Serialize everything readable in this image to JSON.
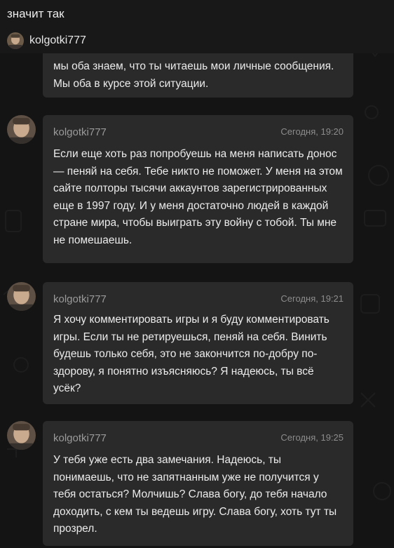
{
  "header": {
    "title": "значит так",
    "user_name": "kolgotki777"
  },
  "messages": [
    {
      "author": "",
      "time": "",
      "text": "мы оба знаем, что ты читаешь мои личные сообщения. Мы оба в курсе этой ситуации."
    },
    {
      "author": "kolgotki777",
      "time": "Сегодня, 19:20",
      "text": "Если еще хоть раз попробуешь на меня написать донос — пеняй на себя. Тебе никто не поможет. У меня на этом сайте полторы тысячи аккаунтов зарегистрированных еще в 1997 году. И у меня достаточно людей в каждой стране мира, чтобы выиграть эту войну с тобой. Ты мне не помешаешь."
    },
    {
      "author": "kolgotki777",
      "time": "Сегодня, 19:21",
      "text": "Я хочу комментировать игры и я буду комментировать игры. Если ты не ретируешься, пеняй на себя. Винить будешь только себя, это не закончится по-добру по-здорову, я понятно изъясняюсь? Я надеюсь, ты всё усёк?"
    },
    {
      "author": "kolgotki777",
      "time": "Сегодня, 19:25",
      "text": "У тебя уже есть два замечания. Надеюсь, ты понимаешь, что не запятнанным уже не получится у тебя остаться? Молчишь? Слава богу, до тебя начало доходить, с кем ты ведешь игру. Слава богу, хоть тут ты прозрел."
    }
  ],
  "colors": {
    "background": "#141414",
    "bubble": "#2a2a2a",
    "author": "#9a9a9a",
    "text": "#ececec"
  }
}
